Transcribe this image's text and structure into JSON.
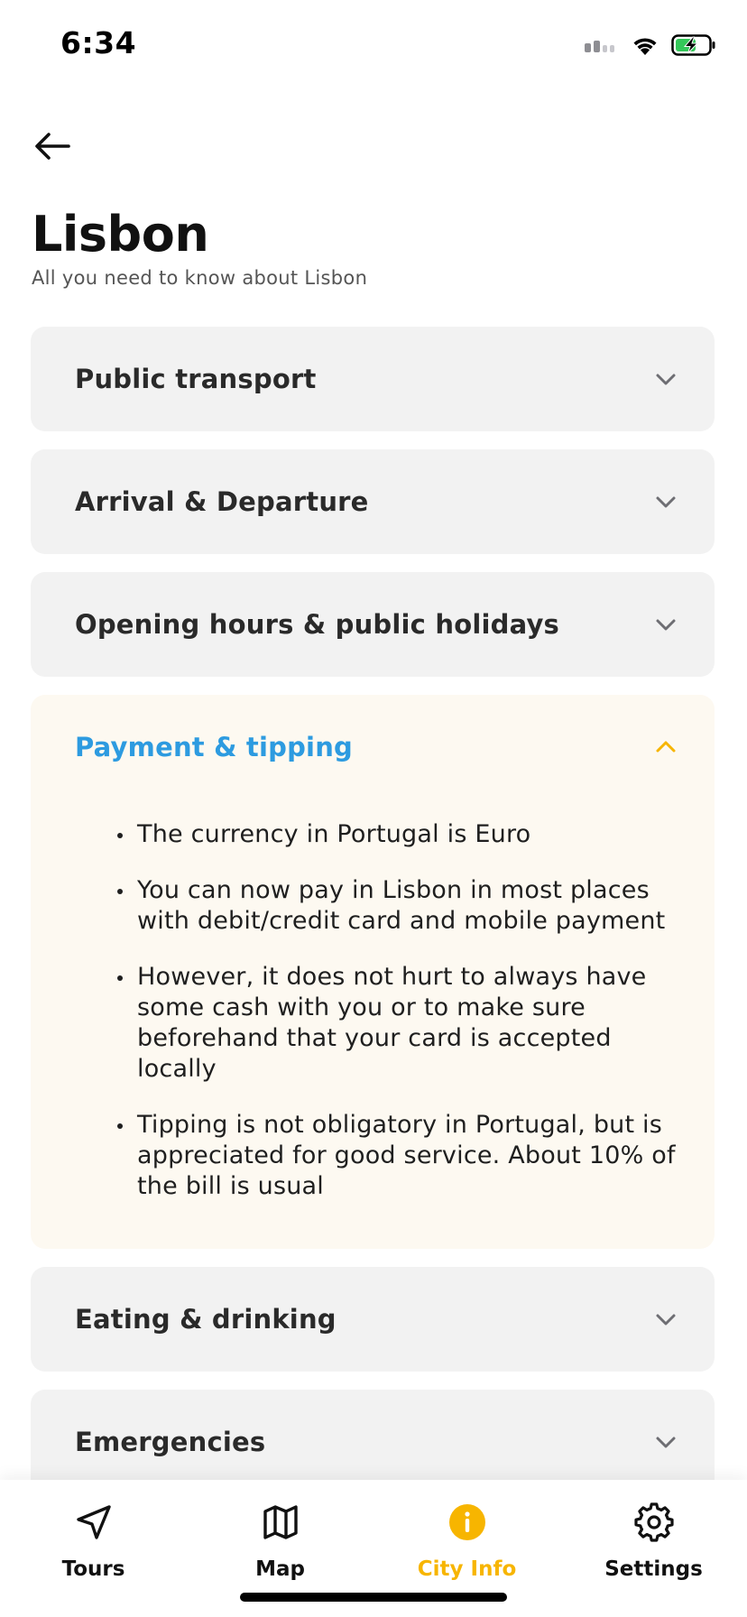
{
  "status_bar": {
    "time": "6:34"
  },
  "header": {
    "title": "Lisbon",
    "subtitle": "All you need to know about Lisbon"
  },
  "accordion": {
    "items": [
      {
        "title": "Public transport",
        "expanded": false
      },
      {
        "title": "Arrival & Departure",
        "expanded": false
      },
      {
        "title": "Opening hours & public holidays",
        "expanded": false
      },
      {
        "title": "Payment & tipping",
        "expanded": true,
        "bullets": [
          "The currency in Portugal is Euro",
          "You can now pay in Lisbon in most places with debit/credit card and mobile payment",
          "However, it does not hurt to always have some cash with you or to make sure beforehand that your card is accepted locally",
          "Tipping is not obligatory in Portugal, but is appreciated for good service. About 10% of the bill is usual"
        ]
      },
      {
        "title": "Eating & drinking",
        "expanded": false
      },
      {
        "title": "Emergencies",
        "expanded": false
      }
    ]
  },
  "tab_bar": {
    "tabs": [
      {
        "label": "Tours",
        "icon": "navigation-arrow-icon",
        "active": false
      },
      {
        "label": "Map",
        "icon": "map-icon",
        "active": false
      },
      {
        "label": "City Info",
        "icon": "info-circle-icon",
        "active": true
      },
      {
        "label": "Settings",
        "icon": "gear-icon",
        "active": false
      }
    ]
  },
  "colors": {
    "accent_blue": "#2d9be0",
    "accent_yellow": "#f7b500",
    "expanded_bg": "#fdf9f1",
    "collapsed_bg": "#f2f2f2"
  }
}
